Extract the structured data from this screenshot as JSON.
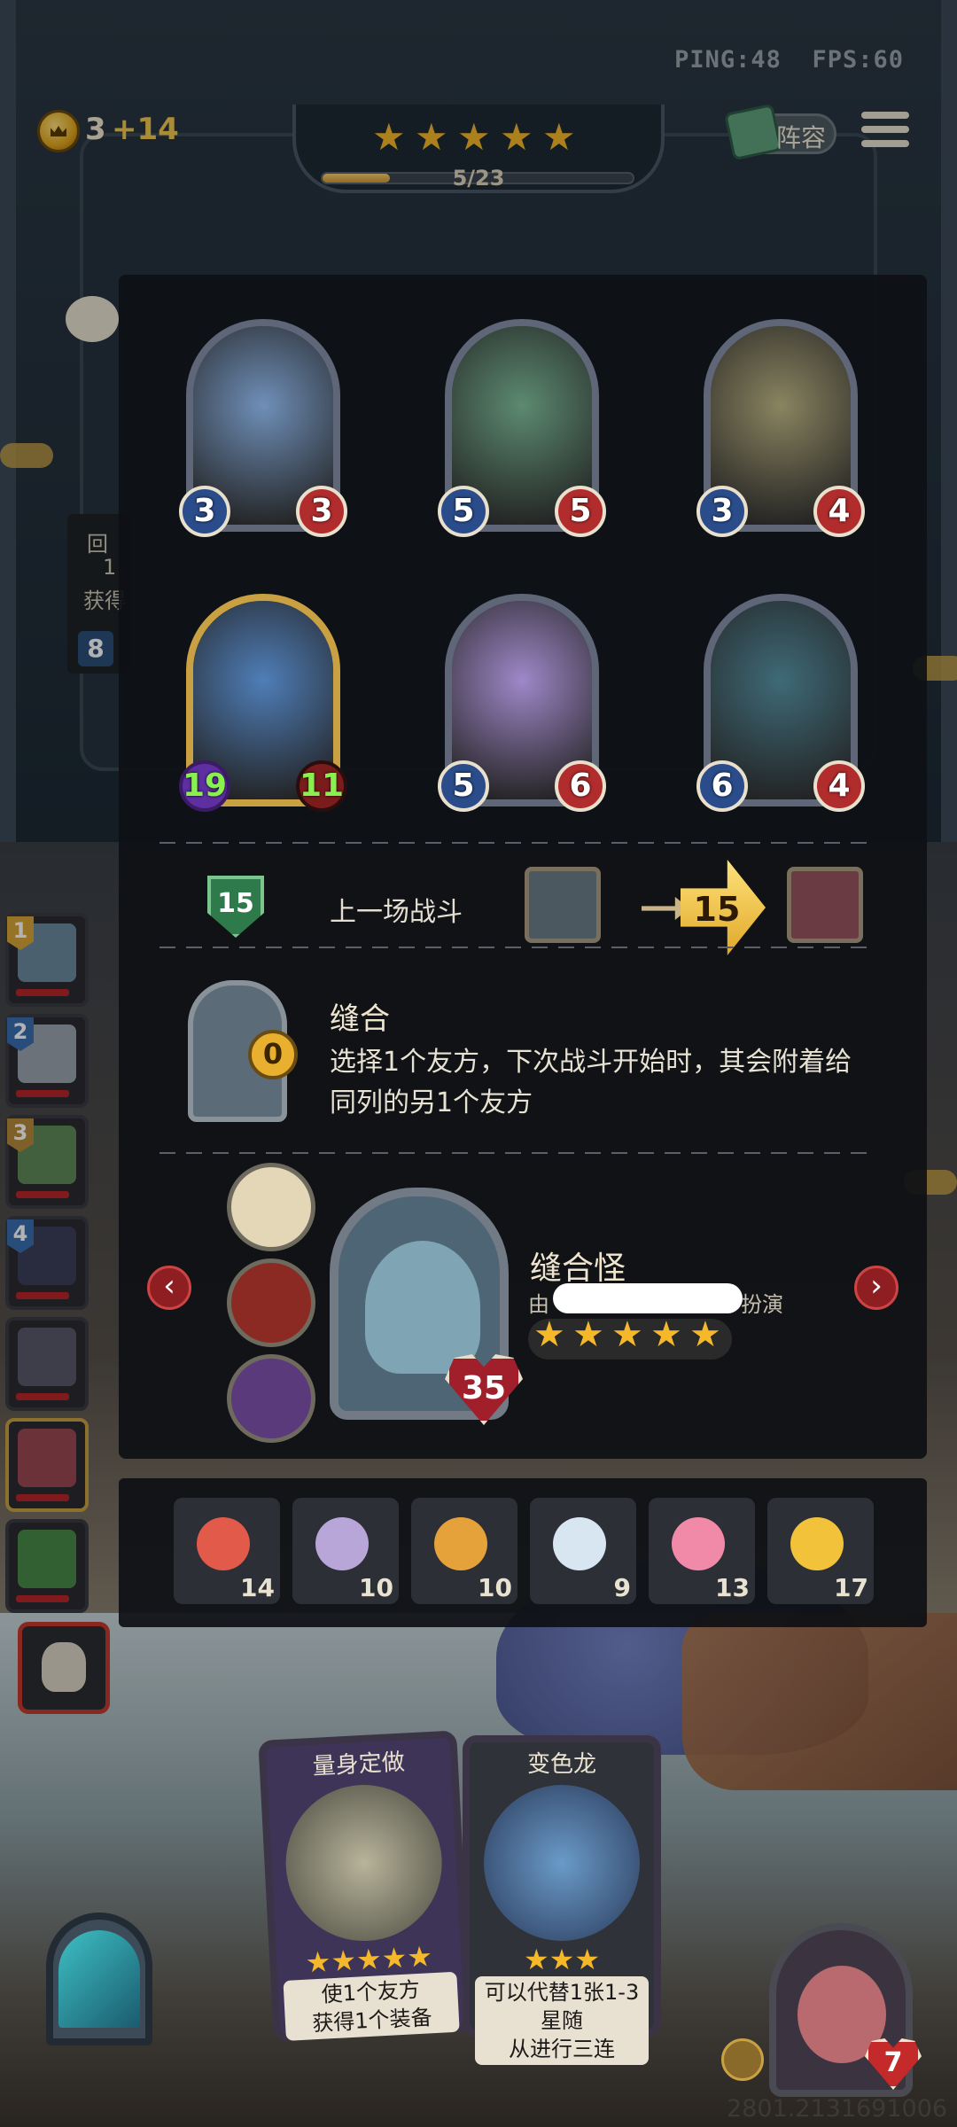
{
  "hud": {
    "ping": "PING:48",
    "fps": "FPS:60",
    "gold": "3",
    "gold_increment": "+14",
    "round_progress": "5/23",
    "round_fraction": 0.217,
    "team_button": "阵容",
    "star_rating": 5
  },
  "roster": [
    {
      "rank": "1",
      "color": "#d8a53a"
    },
    {
      "rank": "2",
      "color": "#3b6fb0"
    },
    {
      "rank": "3",
      "color": "#b58a3a"
    },
    {
      "rank": "4",
      "color": "#3b6fb0"
    },
    {
      "rank": "",
      "color": ""
    },
    {
      "rank": "",
      "color": ""
    },
    {
      "rank": "",
      "color": ""
    }
  ],
  "hidden_left_card": {
    "text_line1": "回",
    "text_line2": "1",
    "text_line3": "获得",
    "value": "8"
  },
  "team_cards": [
    {
      "name": "blue-dragon",
      "atk": "3",
      "hp": "3",
      "color": "#6f8fb8"
    },
    {
      "name": "serpent",
      "atk": "5",
      "hp": "5",
      "color": "#5c8a70"
    },
    {
      "name": "dragon-king",
      "atk": "3",
      "hp": "4",
      "color": "#8a8460"
    },
    {
      "name": "blue-monster",
      "atk": "19",
      "hp": "11",
      "color": "#4f7eb8"
    },
    {
      "name": "princess",
      "atk": "5",
      "hp": "6",
      "color": "#9f88c8"
    },
    {
      "name": "spirit-beast",
      "atk": "6",
      "hp": "4",
      "color": "#3f6a78"
    }
  ],
  "last_battle": {
    "shield_value": "15",
    "label": "上一场战斗",
    "damage": "15"
  },
  "item": {
    "name": "缝合",
    "cost": "0",
    "description_line1": "选择1个友方，下次战斗开始时，其会附着给",
    "description_line2": "同列的另1个友方"
  },
  "character": {
    "name": "缝合怪",
    "credit_prefix": "由",
    "credit_suffix": "扮演",
    "hp": "35",
    "stars": 5
  },
  "tools": [
    {
      "icon": "clown-icon",
      "count": "14",
      "color": "#e25a4a"
    },
    {
      "icon": "shield-emblem-icon",
      "count": "10",
      "color": "#b9a6d8"
    },
    {
      "icon": "alarm-clock-icon",
      "count": "10",
      "color": "#e6a23a"
    },
    {
      "icon": "teacup-icon",
      "count": "9",
      "color": "#d8e6f2"
    },
    {
      "icon": "cake-icon",
      "count": "13",
      "color": "#f08aa8"
    },
    {
      "icon": "chicken-icon",
      "count": "17",
      "color": "#f2c23a"
    }
  ],
  "hand": [
    {
      "title": "量身定做",
      "stars": "★★★★★",
      "desc_line1": "使1个友方",
      "desc_line2": "获得1个装备",
      "bg": "#3e3458"
    },
    {
      "title": "变色龙",
      "stars": "★★★",
      "desc_line1": "可以代替1张1-3星随",
      "desc_line2": "从进行三连",
      "bg": "#2f3238"
    }
  ],
  "hero": {
    "hp": "7"
  },
  "coordinates": "2801.2131691006"
}
